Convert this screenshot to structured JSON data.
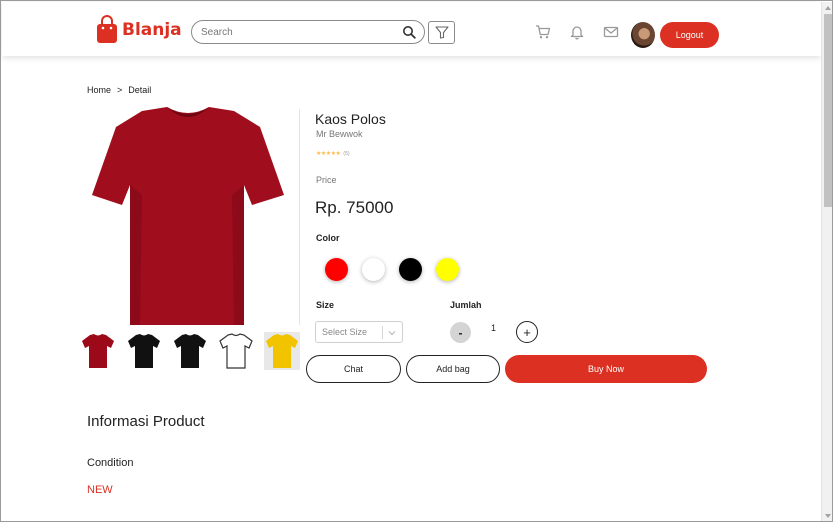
{
  "header": {
    "brand": "Blanja",
    "search_placeholder": "Search",
    "logout_label": "Logout"
  },
  "breadcrumb": {
    "home": "Home",
    "separator": ">",
    "current": "Detail"
  },
  "product": {
    "name": "Kaos Polos",
    "seller": "Mr Bewwok",
    "stars": "★★★★★",
    "rating_count": "(5)",
    "price_label": "Price",
    "price": "Rp. 75000",
    "color_label": "Color",
    "colors": [
      "#ff0000",
      "#ffffff",
      "#000000",
      "#ffff00"
    ],
    "thumbnail_colors": [
      "#9c0a1a",
      "#111111",
      "#111111",
      "#ffffff",
      "#f2c400"
    ],
    "main_image_color": "#a00d1c",
    "size_label": "Size",
    "size_placeholder": "Select Size",
    "quantity_label": "Jumlah",
    "quantity_minus": "-",
    "quantity": "1",
    "quantity_plus": "+"
  },
  "actions": {
    "chat": "Chat",
    "add_bag": "Add bag",
    "buy_now": "Buy Now"
  },
  "info": {
    "title": "Informasi Product",
    "condition_label": "Condition",
    "condition_value": "NEW"
  },
  "colors": {
    "accent": "#db3022"
  }
}
